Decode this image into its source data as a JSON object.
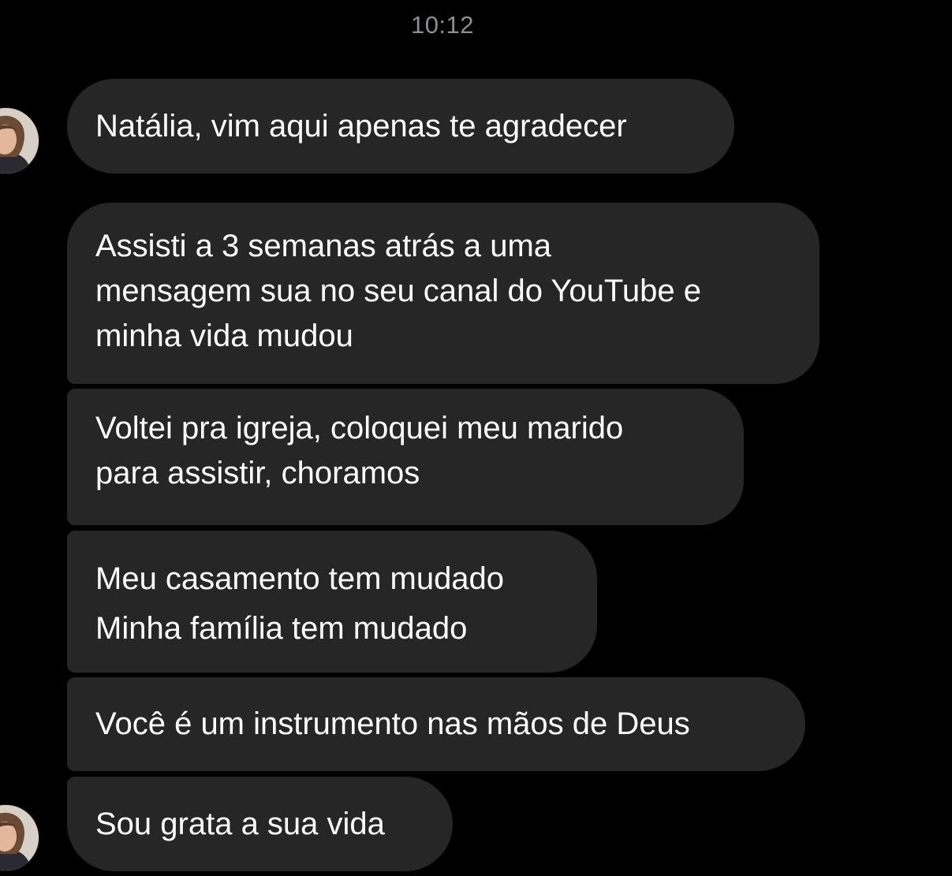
{
  "chat": {
    "timestamp": "10:12",
    "messages": [
      {
        "text": "Natália, vim aqui apenas te agradecer"
      },
      {
        "text": "Assisti a 3 semanas atrás a uma\nmensagem sua no seu canal do YouTube e\nminha vida mudou"
      },
      {
        "text": "Voltei pra igreja, coloquei meu marido\npara assistir, choramos"
      },
      {
        "text": "Meu casamento tem mudado\nMinha família tem mudado"
      },
      {
        "text": "Você é um instrumento nas mãos de Deus"
      },
      {
        "text": "Sou grata a sua vida"
      }
    ],
    "colors": {
      "background": "#000000",
      "bubble": "#262626",
      "text": "#ffffff",
      "timestamp": "#8e8e93"
    },
    "avatar_icon": "profile-photo-icon"
  }
}
